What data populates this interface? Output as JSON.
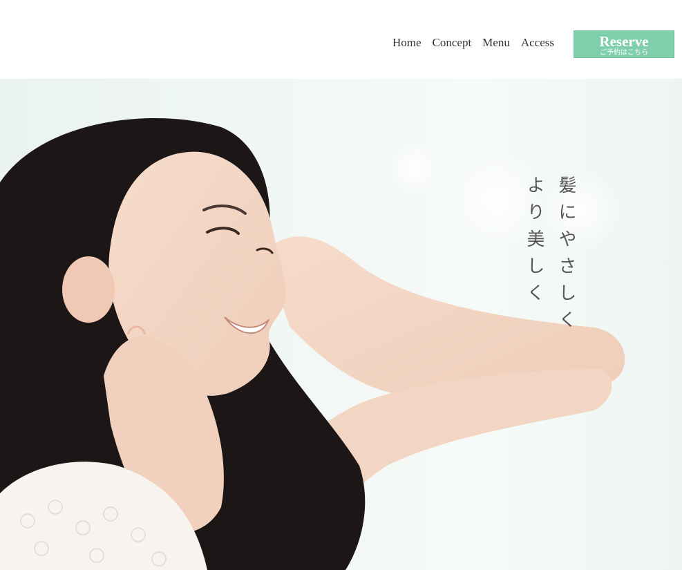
{
  "nav": {
    "items": [
      "Home",
      "Concept",
      "Menu",
      "Access"
    ]
  },
  "reserve": {
    "label": "Reserve",
    "sub_label": "ご予約はこちら"
  },
  "hero": {
    "tagline_line1": "髪にやさしく",
    "tagline_line2": "より美しく"
  },
  "colors": {
    "accent": "#7fcfad",
    "text": "#333333"
  }
}
